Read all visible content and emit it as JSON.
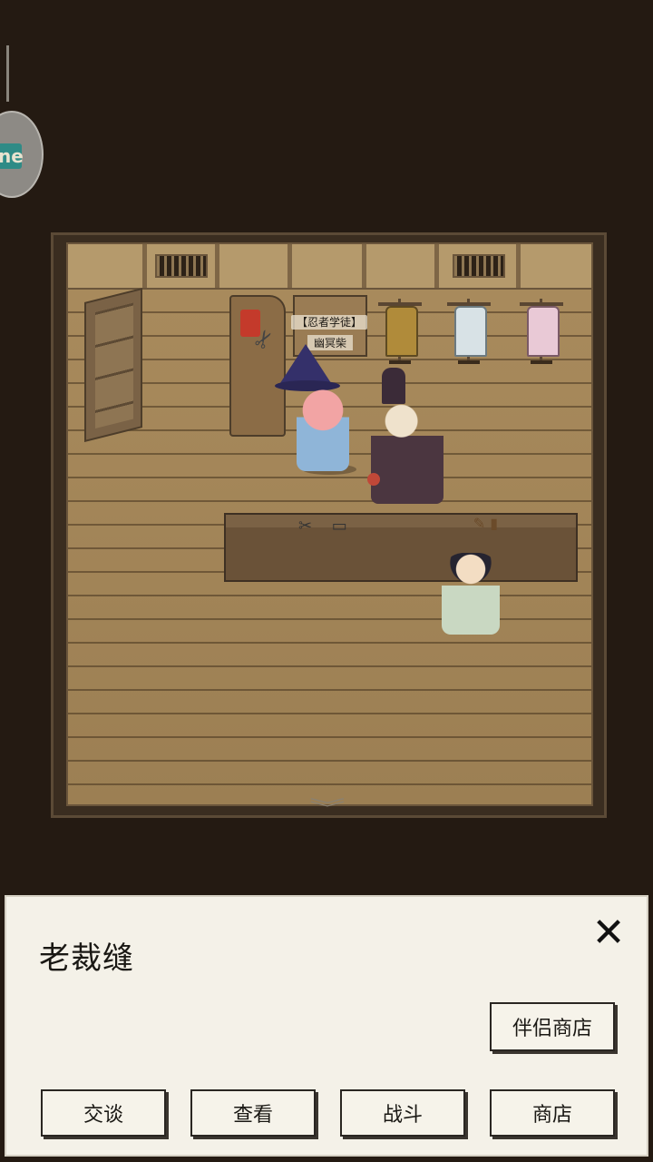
{
  "hud": {
    "badge_icon": "me-badge-icon",
    "badge_text": "ne"
  },
  "scene": {
    "npc_title_tag": "【忍者学徒】",
    "player_name": "幽冥柴",
    "exit_icon": "double-chevron-down-icon"
  },
  "dialog": {
    "npc_name": "老裁缝",
    "close_label": "✕",
    "companion_shop_label": "伴侣商店",
    "actions": [
      "交谈",
      "查看",
      "战斗",
      "商店"
    ]
  },
  "colors": {
    "background": "#241a12",
    "panel": "#f4f1e8",
    "floor": "#a88a5c"
  }
}
